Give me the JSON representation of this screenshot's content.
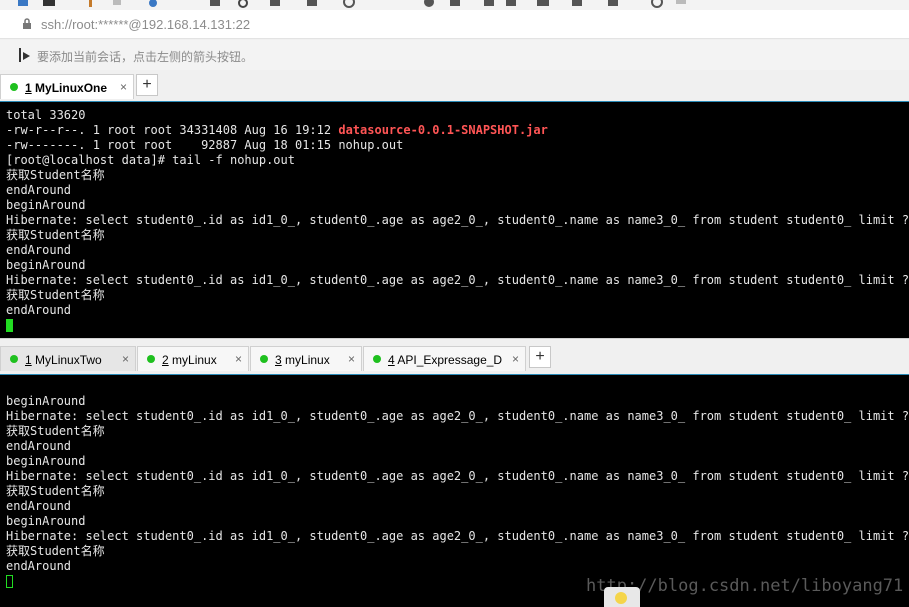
{
  "address": {
    "url": "ssh://root:******@192.168.14.131:22"
  },
  "hint": {
    "text": "要添加当前会话，点击左侧的箭头按钮。"
  },
  "top_pane": {
    "tabs": [
      {
        "num": "1",
        "label": "MyLinuxOne",
        "close": "×"
      }
    ],
    "plus": "+",
    "lines": [
      {
        "text": "total 33620",
        "hl": ""
      },
      {
        "text": "-rw-r--r--. 1 root root 34331408 Aug 16 19:12 ",
        "hl": "datasource-0.0.1-SNAPSHOT.jar"
      },
      {
        "text": "-rw-------. 1 root root    92887 Aug 18 01:15 nohup.out",
        "hl": ""
      },
      {
        "text": "[root@localhost data]# tail -f nohup.out",
        "hl": ""
      },
      {
        "text": "获取Student名称",
        "hl": ""
      },
      {
        "text": "endAround",
        "hl": ""
      },
      {
        "text": "beginAround",
        "hl": ""
      },
      {
        "text": "Hibernate: select student0_.id as id1_0_, student0_.age as age2_0_, student0_.name as name3_0_ from student student0_ limit ?",
        "hl": ""
      },
      {
        "text": "获取Student名称",
        "hl": ""
      },
      {
        "text": "endAround",
        "hl": ""
      },
      {
        "text": "beginAround",
        "hl": ""
      },
      {
        "text": "Hibernate: select student0_.id as id1_0_, student0_.age as age2_0_, student0_.name as name3_0_ from student student0_ limit ?",
        "hl": ""
      },
      {
        "text": "获取Student名称",
        "hl": ""
      },
      {
        "text": "endAround",
        "hl": ""
      }
    ]
  },
  "bottom_pane": {
    "tabs": [
      {
        "num": "1",
        "label": "MyLinuxTwo",
        "close": "×"
      },
      {
        "num": "2",
        "label": "myLinux",
        "close": "×"
      },
      {
        "num": "3",
        "label": "myLinux",
        "close": "×"
      },
      {
        "num": "4",
        "label": "API_Expressage_D",
        "close": "×"
      }
    ],
    "plus": "+",
    "lines": [
      {
        "text": "beginAround",
        "hl": ""
      },
      {
        "text": "Hibernate: select student0_.id as id1_0_, student0_.age as age2_0_, student0_.name as name3_0_ from student student0_ limit ?",
        "hl": ""
      },
      {
        "text": "获取Student名称",
        "hl": ""
      },
      {
        "text": "endAround",
        "hl": ""
      },
      {
        "text": "beginAround",
        "hl": ""
      },
      {
        "text": "Hibernate: select student0_.id as id1_0_, student0_.age as age2_0_, student0_.name as name3_0_ from student student0_ limit ?",
        "hl": ""
      },
      {
        "text": "获取Student名称",
        "hl": ""
      },
      {
        "text": "endAround",
        "hl": ""
      },
      {
        "text": "beginAround",
        "hl": ""
      },
      {
        "text": "Hibernate: select student0_.id as id1_0_, student0_.age as age2_0_, student0_.name as name3_0_ from student student0_ limit ?",
        "hl": ""
      },
      {
        "text": "获取Student名称",
        "hl": ""
      },
      {
        "text": "endAround",
        "hl": ""
      }
    ]
  },
  "watermark": "http://blog.csdn.net/liboyang71",
  "colors": {
    "terminal_bg": "#000000",
    "terminal_fg": "#e6e6e6",
    "highlight": "#ff5555",
    "cursor": "#22dd22",
    "status_dot": "#1fc01f"
  },
  "icons": [
    "toolbar-icons",
    "lock-icon",
    "arrow-icon",
    "close-icon",
    "plus-icon",
    "session-status-icon",
    "lightbulb-icon"
  ]
}
